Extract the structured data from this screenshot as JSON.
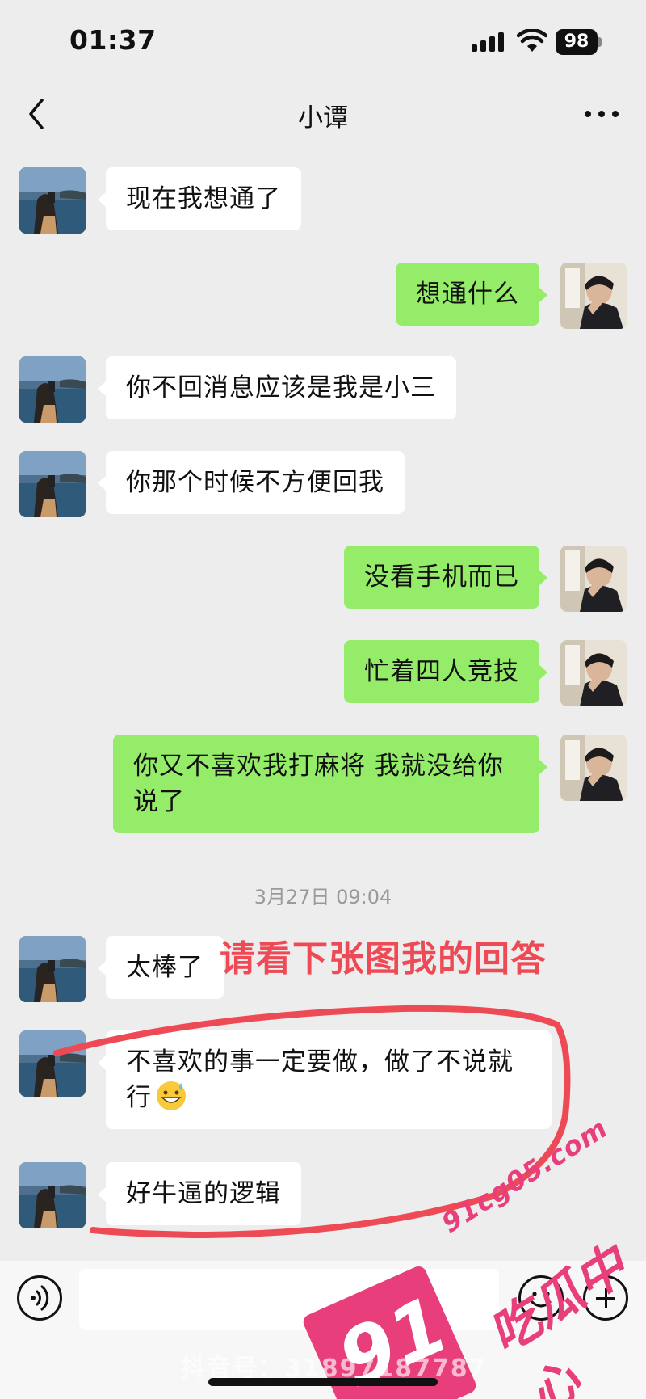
{
  "status_bar": {
    "time": "01:37",
    "battery": "98"
  },
  "nav": {
    "title": "小谭"
  },
  "messages": [
    {
      "side": "in",
      "text": "现在我想通了"
    },
    {
      "side": "out",
      "text": "想通什么"
    },
    {
      "side": "in",
      "text": "你不回消息应该是我是小三"
    },
    {
      "side": "in",
      "text": "你那个时候不方便回我"
    },
    {
      "side": "out",
      "text": "没看手机而已"
    },
    {
      "side": "out",
      "text": "忙着四人竞技"
    },
    {
      "side": "out",
      "text": "你又不喜欢我打麻将 我就没给你说了"
    },
    {
      "side": "in",
      "text": "太棒了"
    },
    {
      "side": "in",
      "text": "不喜欢的事一定要做，做了不说就行",
      "emoji": "grinning-sweat-emoji"
    },
    {
      "side": "in",
      "text": "好牛逼的逻辑"
    }
  ],
  "timestamp": "3月27日 09:04",
  "annotation": {
    "text": "请看下张图我的回答",
    "color": "#ee4a55"
  },
  "watermark": {
    "url": "91cg05.com",
    "name": "吃瓜中心",
    "logo": "91",
    "color": "#e83e7c"
  },
  "tiktok_id": "抖音号：31897187787",
  "colors": {
    "background": "#ededed",
    "bubble_out": "#95ec69",
    "bubble_in": "#ffffff"
  }
}
